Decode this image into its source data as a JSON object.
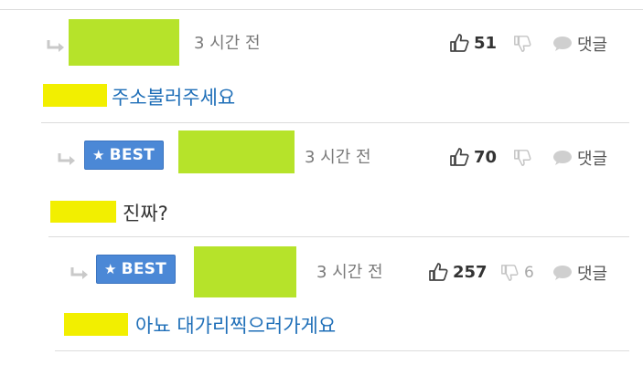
{
  "comments": [
    {
      "time": "3 시간 전",
      "likes": "51",
      "dislikes": "",
      "reply_label": "댓글",
      "text": "주소불러주세요",
      "best": ""
    },
    {
      "time": "3 시간 전",
      "likes": "70",
      "dislikes": "",
      "reply_label": "댓글",
      "text": "진짜?",
      "best": "BEST"
    },
    {
      "time": "3 시간 전",
      "likes": "257",
      "dislikes": "6",
      "reply_label": "댓글",
      "text": "아뇨 대가리찍으러가게요",
      "best": "BEST"
    }
  ],
  "colors": {
    "nick_highlight": "#b6e32a",
    "mention_highlight": "#f2ef00",
    "best_badge": "#4b88d6",
    "comment_blue": "#1f6fb8"
  },
  "icons": [
    "reply-arrow-icon",
    "star-icon",
    "thumbs-up-icon",
    "thumbs-down-icon",
    "speech-bubble-icon"
  ]
}
